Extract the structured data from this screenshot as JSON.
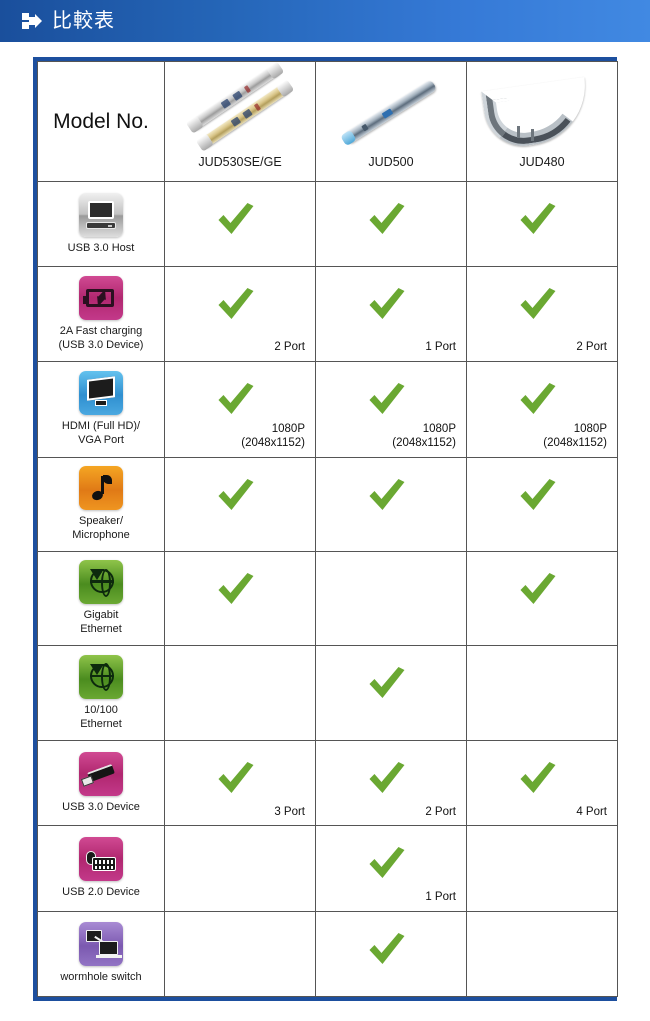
{
  "header": {
    "icon": "arrow-blocks-icon",
    "title": "比較表"
  },
  "table": {
    "first_column_header": "Model No.",
    "products": [
      {
        "name": "JUD530SE/GE",
        "image": "dual-docking-station-silver-gold"
      },
      {
        "name": "JUD500",
        "image": "slim-docking-station-dark"
      },
      {
        "name": "JUD480",
        "image": "curved-docking-station-silver"
      }
    ],
    "rows": [
      {
        "icon": "computer-monitor-icon",
        "icon_color": "#b0b0b0",
        "label": "USB 3.0 Host",
        "cells": [
          {
            "check": true,
            "note": ""
          },
          {
            "check": true,
            "note": ""
          },
          {
            "check": true,
            "note": ""
          }
        ]
      },
      {
        "icon": "battery-charging-icon",
        "icon_color": "#c3398a",
        "label": "2A Fast charging\n(USB 3.0 Device)",
        "cells": [
          {
            "check": true,
            "note": "2 Port"
          },
          {
            "check": true,
            "note": "1 Port"
          },
          {
            "check": true,
            "note": "2 Port"
          }
        ]
      },
      {
        "icon": "display-monitor-icon",
        "icon_color": "#3d9ad8",
        "label": "HDMI (Full HD)/\nVGA Port",
        "cells": [
          {
            "check": true,
            "note": "1080P\n(2048x1152)"
          },
          {
            "check": true,
            "note": "1080P\n(2048x1152)"
          },
          {
            "check": true,
            "note": "1080P\n(2048x1152)"
          }
        ]
      },
      {
        "icon": "music-note-icon",
        "icon_color": "#ef9520",
        "label": "Speaker/\nMicrophone",
        "cells": [
          {
            "check": true,
            "note": ""
          },
          {
            "check": true,
            "note": ""
          },
          {
            "check": true,
            "note": ""
          }
        ]
      },
      {
        "icon": "globe-download-icon",
        "icon_color": "#6aa832",
        "label": "Gigabit\nEthernet",
        "cells": [
          {
            "check": true,
            "note": ""
          },
          {
            "check": false,
            "note": ""
          },
          {
            "check": true,
            "note": ""
          }
        ]
      },
      {
        "icon": "globe-download-icon",
        "icon_color": "#6aa832",
        "label": "10/100\nEthernet",
        "cells": [
          {
            "check": false,
            "note": ""
          },
          {
            "check": true,
            "note": ""
          },
          {
            "check": false,
            "note": ""
          }
        ]
      },
      {
        "icon": "usb-flash-drive-icon",
        "icon_color": "#c3398a",
        "label": "USB 3.0 Device",
        "cells": [
          {
            "check": true,
            "note": "3 Port"
          },
          {
            "check": true,
            "note": "2 Port"
          },
          {
            "check": true,
            "note": "4 Port"
          }
        ]
      },
      {
        "icon": "keyboard-mouse-icon",
        "icon_color": "#c3398a",
        "label": "USB 2.0 Device",
        "cells": [
          {
            "check": false,
            "note": ""
          },
          {
            "check": true,
            "note": "1 Port"
          },
          {
            "check": false,
            "note": ""
          }
        ]
      },
      {
        "icon": "two-computers-icon",
        "icon_color": "#9274c4",
        "label": "wormhole switch",
        "cells": [
          {
            "check": false,
            "note": ""
          },
          {
            "check": true,
            "note": ""
          },
          {
            "check": false,
            "note": ""
          }
        ]
      }
    ]
  },
  "colors": {
    "header_gradient_start": "#1a4f9c",
    "header_gradient_end": "#4189e2",
    "table_border": "#1d4f9e",
    "check_green": "#6aa832",
    "cell_border": "#555555"
  }
}
